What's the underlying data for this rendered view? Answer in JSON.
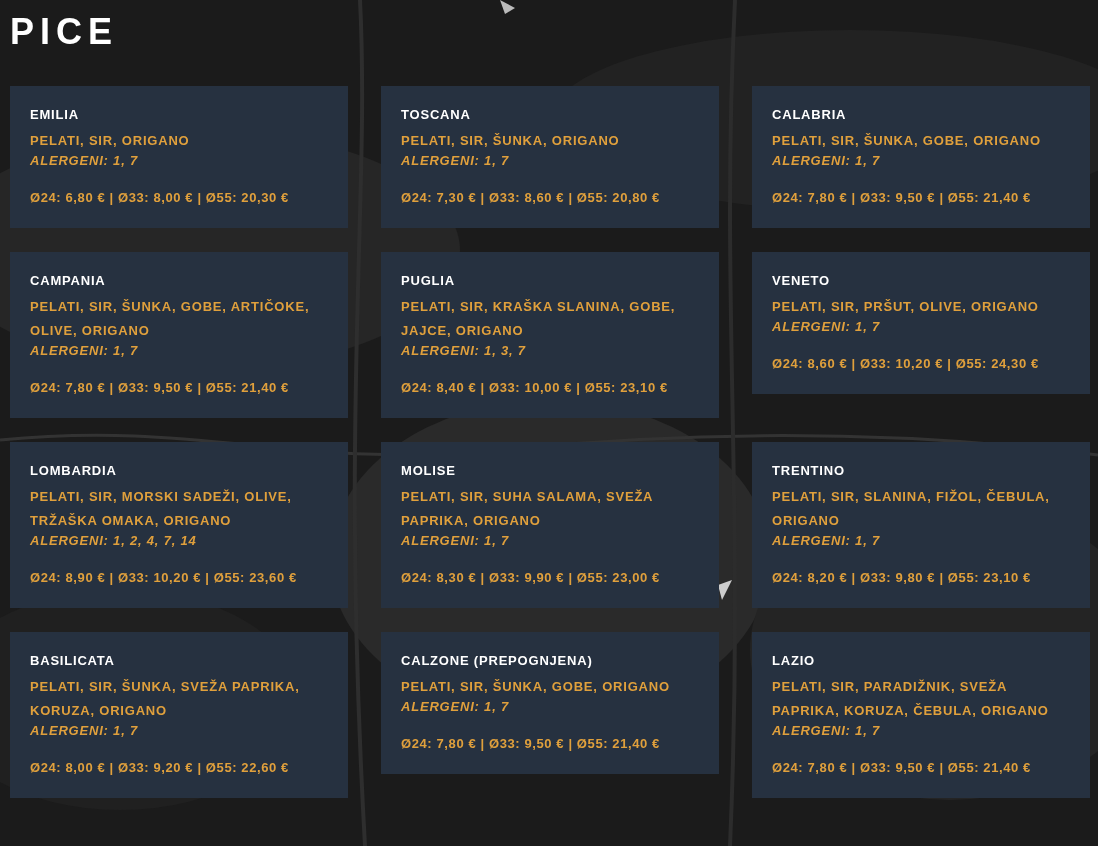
{
  "title": "PICE",
  "pizzas": [
    {
      "name": "EMILIA",
      "ingredients": "PELATI, SIR, ORIGANO",
      "allergens": "ALERGENI: 1, 7",
      "prices": "Ø24: 6,80 € | Ø33: 8,00 € | Ø55: 20,30 €"
    },
    {
      "name": "TOSCANA",
      "ingredients": "PELATI, SIR, ŠUNKA, ORIGANO",
      "allergens": "ALERGENI: 1, 7",
      "prices": "Ø24: 7,30 € | Ø33: 8,60 € | Ø55: 20,80 €"
    },
    {
      "name": "CALABRIA",
      "ingredients": "PELATI, SIR, ŠUNKA, GOBE, ORIGANO",
      "allergens": "ALERGENI: 1, 7",
      "prices": "Ø24: 7,80 € | Ø33: 9,50 € | Ø55: 21,40 €"
    },
    {
      "name": "CAMPANIA",
      "ingredients": "PELATI, SIR, ŠUNKA, GOBE, ARTIČOKE, OLIVE, ORIGANO",
      "allergens": "ALERGENI: 1, 7",
      "prices": "Ø24: 7,80 € | Ø33: 9,50 € | Ø55: 21,40 €"
    },
    {
      "name": "PUGLIA",
      "ingredients": "PELATI, SIR, KRAŠKA SLANINA, GOBE, JAJCE, ORIGANO",
      "allergens": "ALERGENI: 1, 3, 7",
      "prices": "Ø24: 8,40 € | Ø33: 10,00 € | Ø55: 23,10 €"
    },
    {
      "name": "VENETO",
      "ingredients": "PELATI, SIR, PRŠUT, OLIVE, ORIGANO",
      "allergens": "ALERGENI: 1, 7",
      "prices": "Ø24: 8,60 € | Ø33: 10,20 € | Ø55: 24,30 €"
    },
    {
      "name": "LOMBARDIA",
      "ingredients": "PELATI, SIR, MORSKI SADEŽI, OLIVE, TRŽAŠKA OMAKA, ORIGANO",
      "allergens": "ALERGENI: 1, 2, 4, 7, 14",
      "prices": "Ø24: 8,90 € | Ø33: 10,20 € | Ø55: 23,60 €"
    },
    {
      "name": "MOLISE",
      "ingredients": "PELATI, SIR, SUHA SALAMA, SVEŽA PAPRIKA, ORIGANO",
      "allergens": "ALERGENI: 1, 7",
      "prices": "Ø24: 8,30 € | Ø33: 9,90 € | Ø55: 23,00 €"
    },
    {
      "name": "TRENTINO",
      "ingredients": "PELATI, SIR, SLANINA, FIŽOL, ČEBULA, ORIGANO",
      "allergens": "ALERGENI: 1, 7",
      "prices": "Ø24: 8,20 € | Ø33: 9,80 € | Ø55: 23,10 €"
    },
    {
      "name": "BASILICATA",
      "ingredients": "PELATI, SIR, ŠUNKA, SVEŽA PAPRIKA, KORUZA, ORIGANO",
      "allergens": "ALERGENI: 1, 7",
      "prices": "Ø24: 8,00 € | Ø33: 9,20 € | Ø55: 22,60 €"
    },
    {
      "name": "CALZONE (PREPOGNJENA)",
      "ingredients": "PELATI, SIR, ŠUNKA, GOBE, ORIGANO",
      "allergens": "ALERGENI: 1, 7",
      "prices": "Ø24: 7,80 € | Ø33: 9,50 € | Ø55: 21,40 €"
    },
    {
      "name": "LAZIO",
      "ingredients": "PELATI, SIR, PARADIŽNIK, SVEŽA PAPRIKA, KORUZA, ČEBULA, ORIGANO",
      "allergens": "ALERGENI: 1, 7",
      "prices": "Ø24: 7,80 € | Ø33: 9,50 € | Ø55: 21,40 €"
    }
  ]
}
